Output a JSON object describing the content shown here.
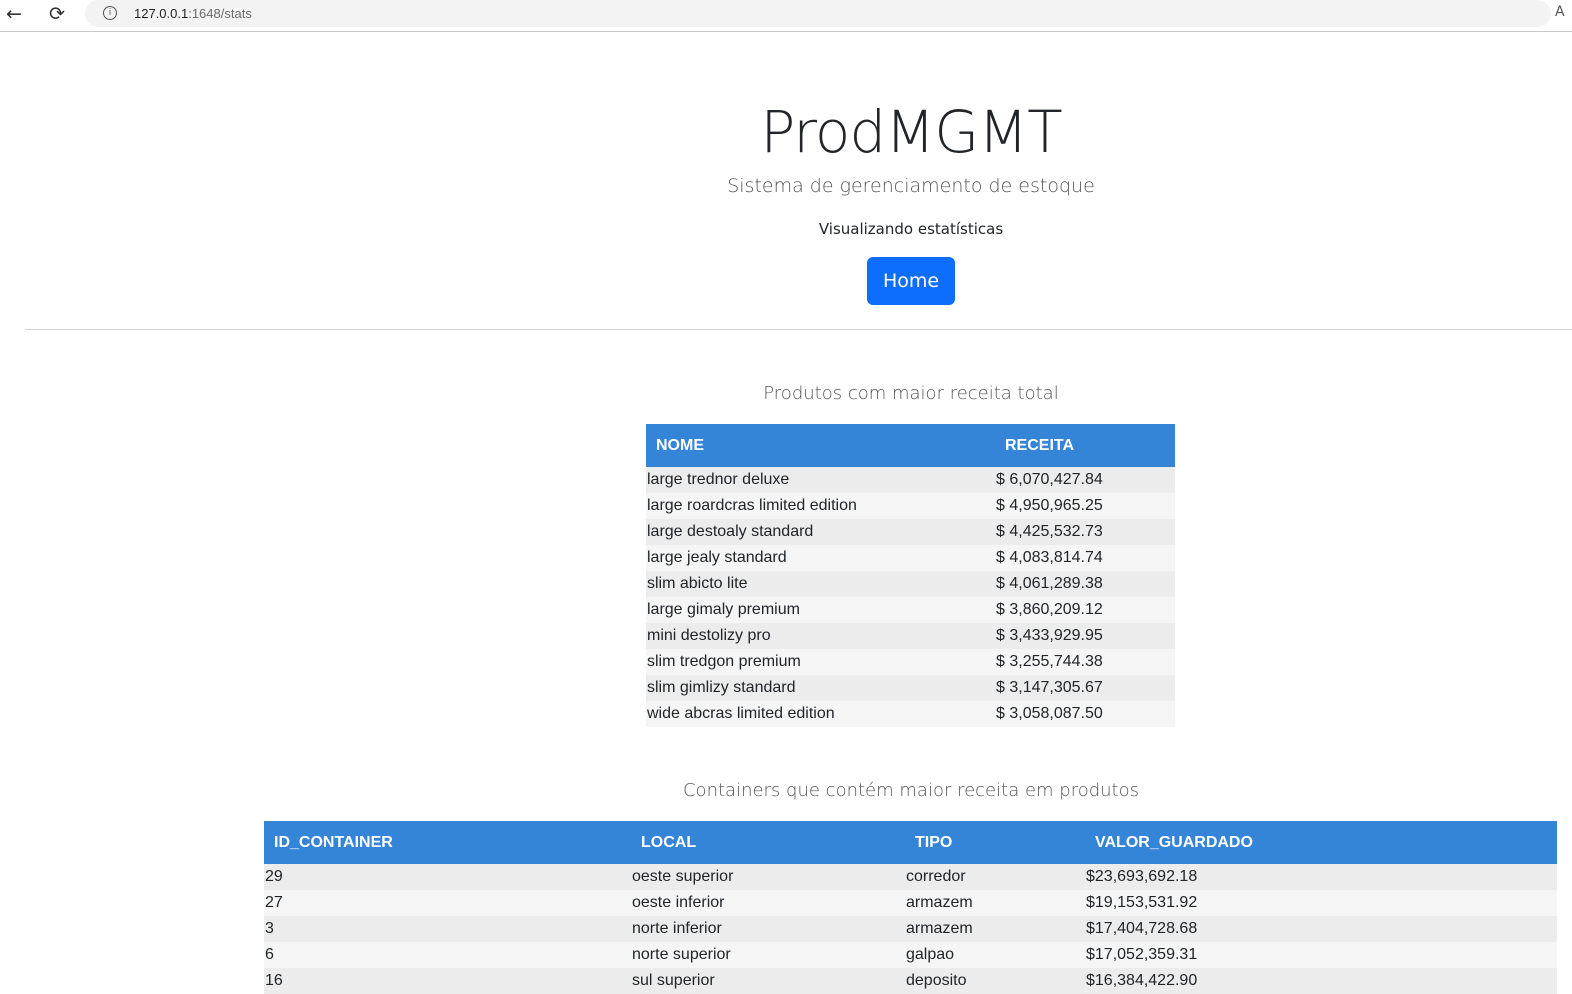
{
  "browser": {
    "back_icon": "←",
    "reload_icon": "⟳",
    "info_icon": "i",
    "url_host": "127.0.0.1",
    "url_rest": ":1648/stats",
    "reader_icon": "A"
  },
  "header": {
    "title": "ProdMGMT",
    "subtitle": "Sistema de gerenciamento de estoque",
    "viewing": "Visualizando estatísticas",
    "home_button": "Home"
  },
  "products": {
    "title": "Produtos com maior receita total",
    "columns": [
      "NOME",
      "RECEITA"
    ],
    "rows": [
      [
        "large trednor deluxe",
        "$ 6,070,427.84"
      ],
      [
        "large roardcras limited edition",
        "$ 4,950,965.25"
      ],
      [
        "large destoaly standard",
        "$ 4,425,532.73"
      ],
      [
        "large jealy standard",
        "$ 4,083,814.74"
      ],
      [
        "slim abicto lite",
        "$ 4,061,289.38"
      ],
      [
        "large gimaly premium",
        "$ 3,860,209.12"
      ],
      [
        "mini destolizy pro",
        "$ 3,433,929.95"
      ],
      [
        "slim tredgon premium",
        "$ 3,255,744.38"
      ],
      [
        "slim gimlizy standard",
        "$ 3,147,305.67"
      ],
      [
        "wide abcras limited edition",
        "$ 3,058,087.50"
      ]
    ]
  },
  "containers": {
    "title": "Containers que contém maior receita em produtos",
    "columns": [
      "ID_CONTAINER",
      "LOCAL",
      "TIPO",
      "VALOR_GUARDADO"
    ],
    "rows": [
      [
        "29",
        "oeste superior",
        "corredor",
        "$23,693,692.18"
      ],
      [
        "27",
        "oeste inferior",
        "armazem",
        "$19,153,531.92"
      ],
      [
        "3",
        "norte inferior",
        "armazem",
        "$17,404,728.68"
      ],
      [
        "6",
        "norte superior",
        "galpao",
        "$17,052,359.31"
      ],
      [
        "16",
        "sul superior",
        "deposito",
        "$16,384,422.90"
      ]
    ]
  },
  "colors": {
    "primary_button": "#0d6efd",
    "table_header": "#3484d8"
  }
}
